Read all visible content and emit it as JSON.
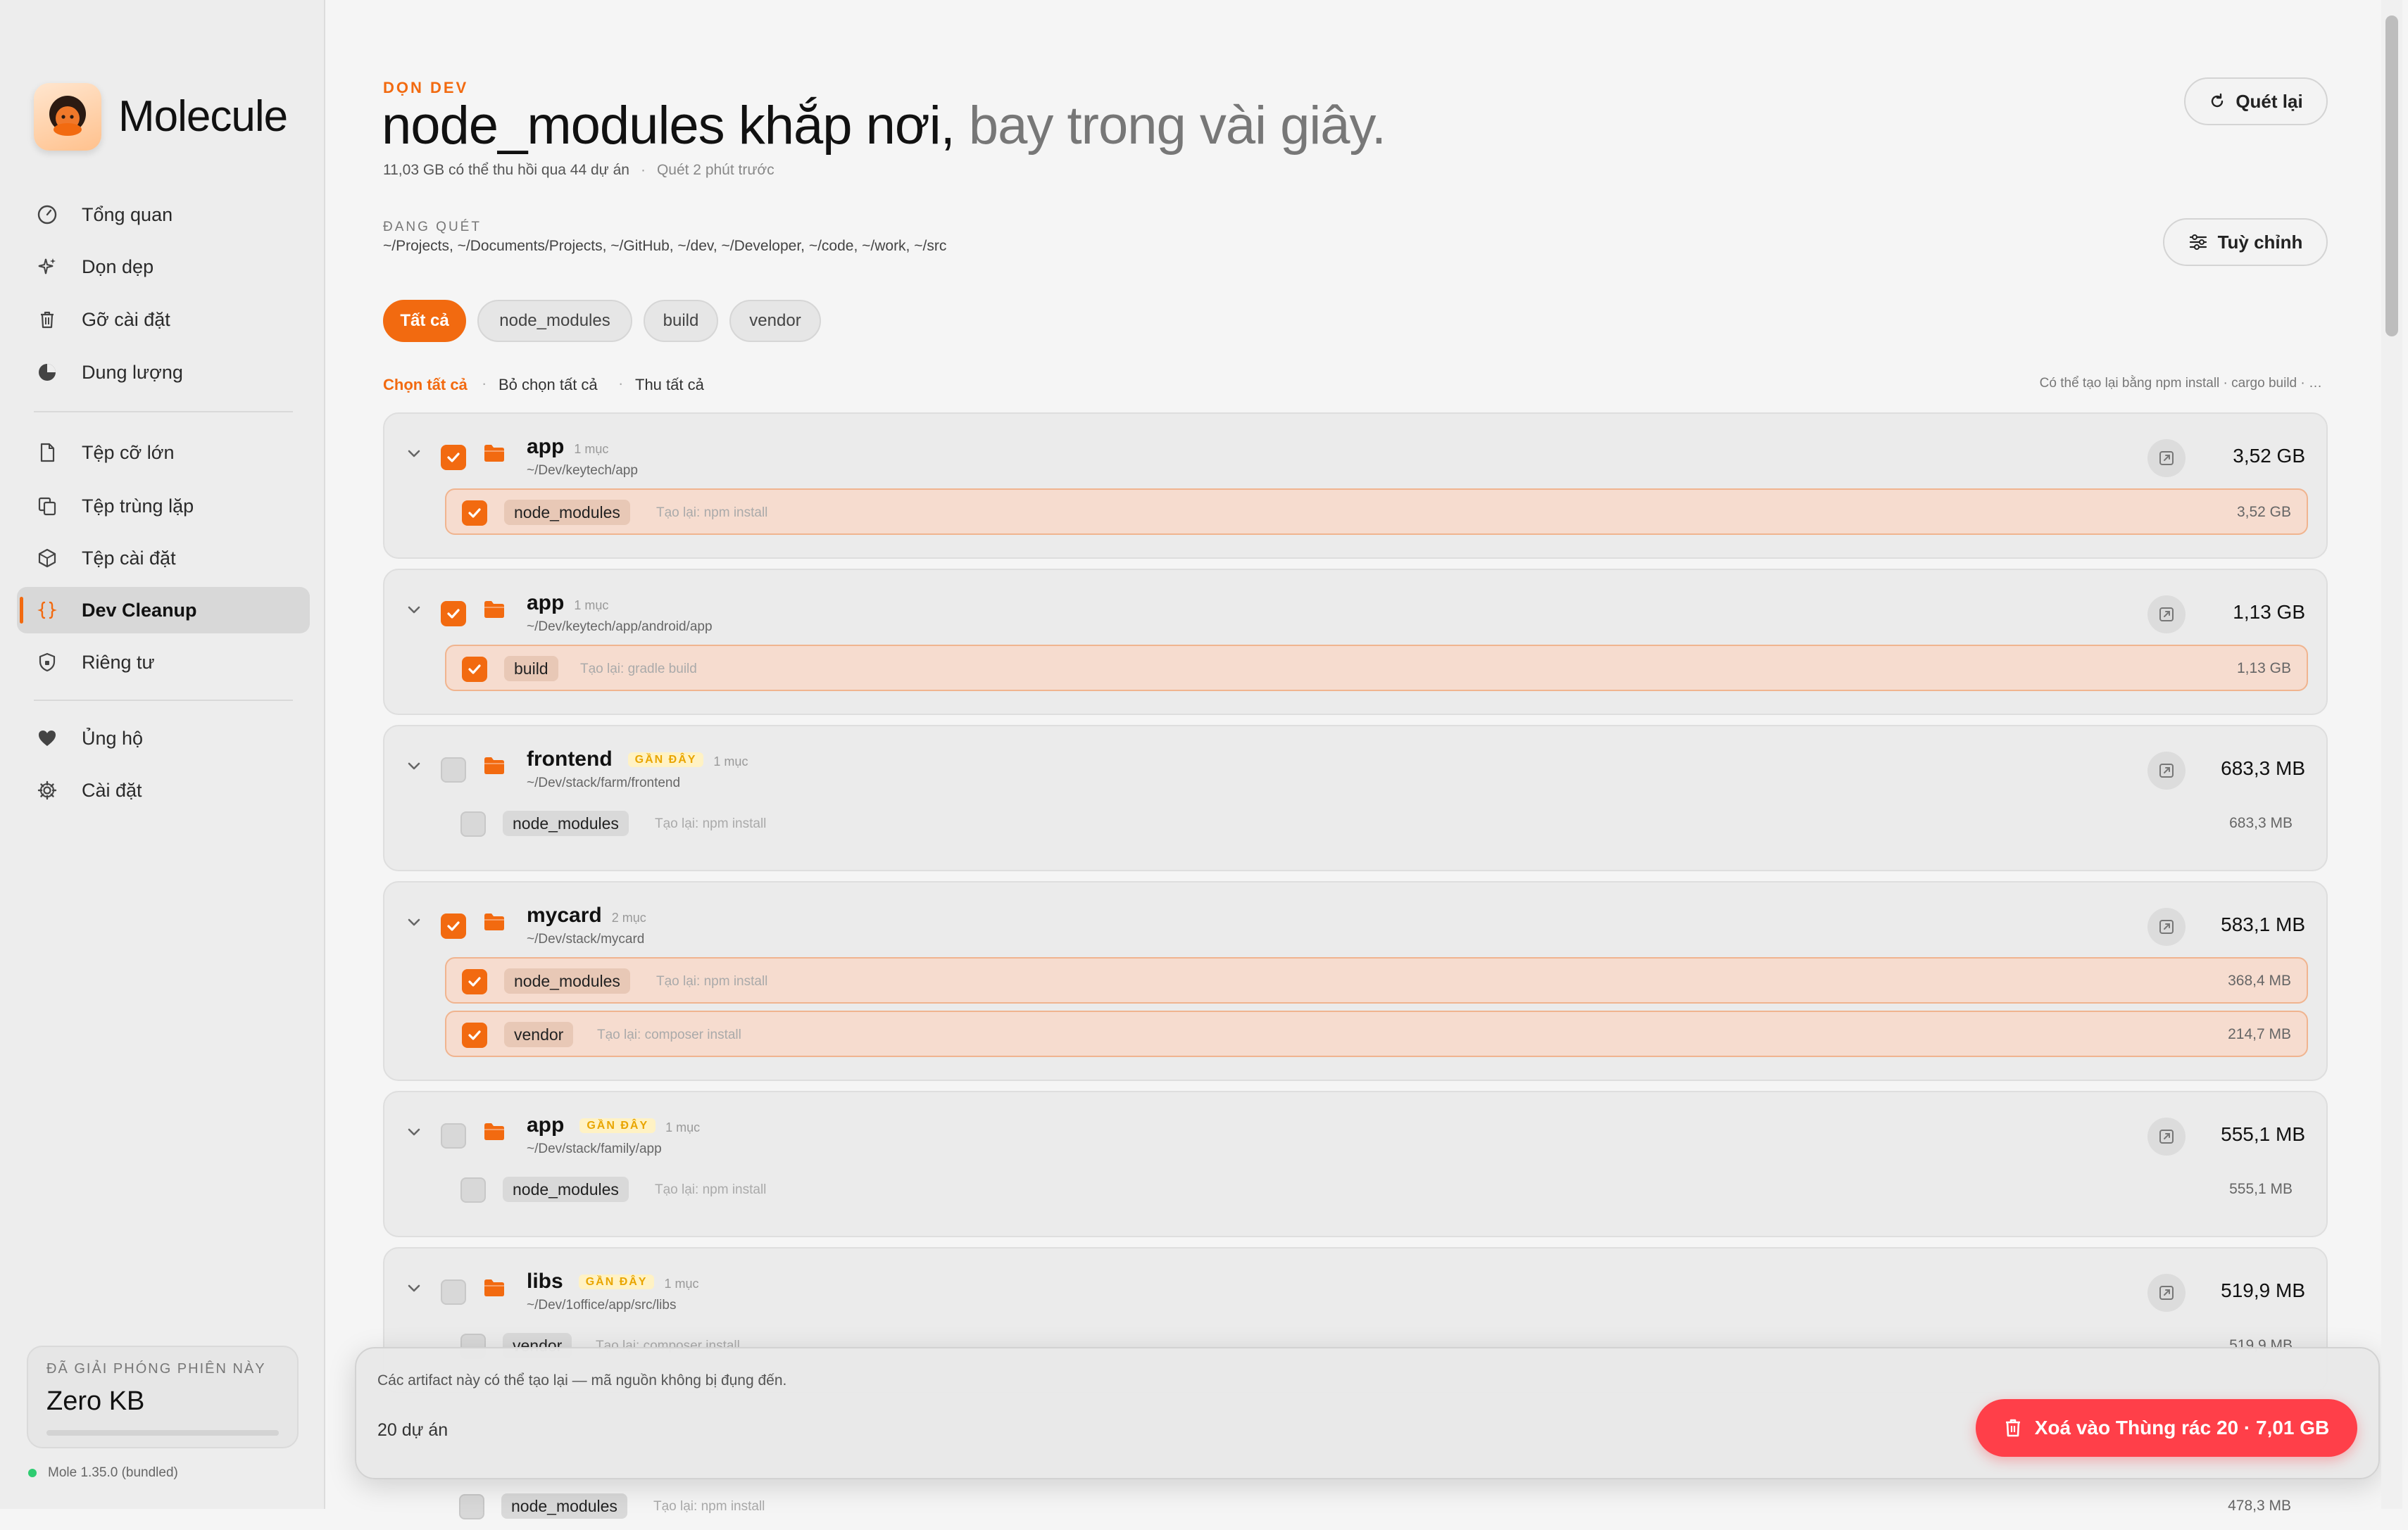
{
  "app": {
    "name": "Molecule"
  },
  "sidebar": {
    "items": [
      {
        "label": "Tổng quan",
        "icon": "gauge-icon"
      },
      {
        "label": "Dọn dẹp",
        "icon": "sparkle-icon"
      },
      {
        "label": "Gỡ cài đặt",
        "icon": "trash-icon"
      },
      {
        "label": "Dung lượng",
        "icon": "pie-chart-icon"
      },
      {
        "label": "Tệp cỡ lớn",
        "icon": "large-file-icon"
      },
      {
        "label": "Tệp trùng lặp",
        "icon": "duplicate-icon"
      },
      {
        "label": "Tệp cài đặt",
        "icon": "package-icon"
      },
      {
        "label": "Dev Cleanup",
        "icon": "braces-icon",
        "active": true
      },
      {
        "label": "Riêng tư",
        "icon": "shield-icon"
      },
      {
        "label": "Ủng hộ",
        "icon": "heart-icon"
      },
      {
        "label": "Cài đặt",
        "icon": "gear-icon"
      }
    ],
    "freed": {
      "label": "ĐÃ GIẢI PHÓNG PHIÊN NÀY",
      "value": "Zero KB",
      "progress": 0
    },
    "version": "Mole 1.35.0 (bundled)",
    "version_status_color": "#2ecc71"
  },
  "header": {
    "eyebrow": "DỌN DEV",
    "title_main": "node_modules khắp nơi,",
    "title_sub": "bay trong vài giây.",
    "summary": "11,03 GB có thể thu hồi qua 44 dự án",
    "summary_sep": "·",
    "scan_time": "Quét 2 phút trước",
    "rescan_label": "Quét lại",
    "scanning_label": "ĐANG QUÉT",
    "scan_paths": "~/Projects, ~/Documents/Projects, ~/GitHub, ~/dev, ~/Developer, ~/code, ~/work, ~/src",
    "customize_label": "Tuỳ chỉnh"
  },
  "filters": [
    "Tất cả",
    "node_modules",
    "build",
    "vendor"
  ],
  "actions": {
    "select_all": "Chọn tất cả",
    "deselect_all": "Bỏ chọn tất cả",
    "collapse_all": "Thu tất cả",
    "sep": "·",
    "hint": "Có thể tạo lại bằng npm install · cargo build · …"
  },
  "projects": [
    {
      "name": "app",
      "count": "1 mục",
      "badge": "",
      "path": "~/Dev/keytech/app",
      "size": "3,52 GB",
      "checked": true,
      "artifacts": [
        {
          "name": "node_modules",
          "hint": "Tạo lại: npm install",
          "size": "3,52 GB",
          "checked": true
        }
      ]
    },
    {
      "name": "app",
      "count": "1 mục",
      "badge": "",
      "path": "~/Dev/keytech/app/android/app",
      "size": "1,13 GB",
      "checked": true,
      "artifacts": [
        {
          "name": "build",
          "hint": "Tạo lại: gradle build",
          "size": "1,13 GB",
          "checked": true
        }
      ]
    },
    {
      "name": "frontend",
      "count": "1 mục",
      "badge": "GẦN ĐÂY",
      "path": "~/Dev/stack/farm/frontend",
      "size": "683,3 MB",
      "checked": false,
      "artifacts": [
        {
          "name": "node_modules",
          "hint": "Tạo lại: npm install",
          "size": "683,3 MB",
          "checked": false
        }
      ]
    },
    {
      "name": "mycard",
      "count": "2 mục",
      "badge": "",
      "path": "~/Dev/stack/mycard",
      "size": "583,1 MB",
      "checked": true,
      "artifacts": [
        {
          "name": "node_modules",
          "hint": "Tạo lại: npm install",
          "size": "368,4 MB",
          "checked": true
        },
        {
          "name": "vendor",
          "hint": "Tạo lại: composer install",
          "size": "214,7 MB",
          "checked": true
        }
      ]
    },
    {
      "name": "app",
      "count": "1 mục",
      "badge": "GẦN ĐÂY",
      "path": "~/Dev/stack/family/app",
      "size": "555,1 MB",
      "checked": false,
      "artifacts": [
        {
          "name": "node_modules",
          "hint": "Tạo lại: npm install",
          "size": "555,1 MB",
          "checked": false
        }
      ]
    },
    {
      "name": "libs",
      "count": "1 mục",
      "badge": "GẦN ĐÂY",
      "path": "~/Dev/1office/app/src/libs",
      "size": "519,9 MB",
      "checked": false,
      "artifacts": [
        {
          "name": "vendor",
          "hint": "Tạo lại: composer install",
          "size": "519,9 MB",
          "checked": false
        }
      ]
    }
  ],
  "peek_row": {
    "name": "node_modules",
    "hint": "Tạo lại: npm install",
    "size": "478,3 MB"
  },
  "bottom_bar": {
    "note": "Các artifact này có thể tạo lại — mã nguồn không bị đụng đến.",
    "count": "20 dự án",
    "trash_label": "Xoá vào Thùng rác 20 · 7,01 GB"
  },
  "colors": {
    "accent": "#f26a10",
    "danger": "#ff3f49",
    "recent_badge": "#e9a500"
  }
}
